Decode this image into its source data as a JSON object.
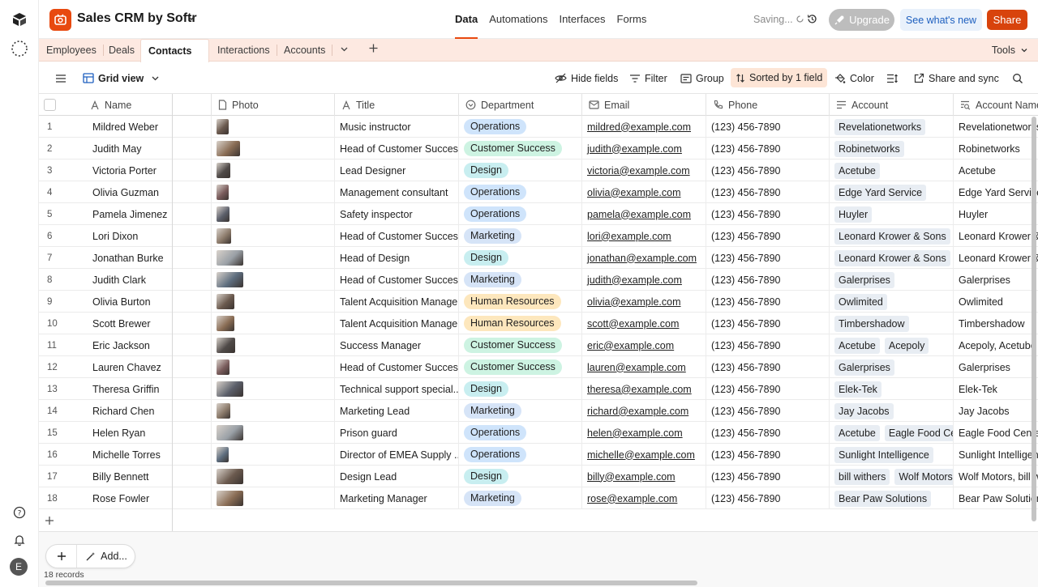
{
  "header": {
    "base_name": "Sales CRM by Softr",
    "nav": [
      "Data",
      "Automations",
      "Interfaces",
      "Forms"
    ],
    "active_nav": "Data",
    "saving": "Saving...",
    "upgrade": "Upgrade",
    "whats_new": "See what's new",
    "share": "Share"
  },
  "rail": {
    "avatar": "E"
  },
  "tabs": {
    "items": [
      "Employees",
      "Deals",
      "Contacts",
      "Interactions",
      "Accounts"
    ],
    "active": "Contacts",
    "tools": "Tools"
  },
  "viewbar": {
    "view_name": "Grid view",
    "hide_fields": "Hide fields",
    "filter": "Filter",
    "group": "Group",
    "sorted": "Sorted by 1 field",
    "color": "Color",
    "share_sync": "Share and sync"
  },
  "columns": [
    "Name",
    "Photo",
    "Title",
    "Department",
    "Email",
    "Phone",
    "Account",
    "Account Name"
  ],
  "departments": {
    "Operations": "#cfe4fb",
    "Customer Success": "#cdf3e2",
    "Design": "#c8eef0",
    "Marketing": "#d6e4f7",
    "Human Resources": "#fde7bd"
  },
  "rows": [
    {
      "n": "1",
      "name": "Mildred Weber",
      "photo_w": 15,
      "title": "Music instructor",
      "dept": "Operations",
      "email": "mildred@example.com",
      "phone": "(123) 456-7890",
      "accounts": [
        "Revelationetworks"
      ],
      "account_name": "Revelationetworks"
    },
    {
      "n": "2",
      "name": "Judith May",
      "photo_w": 29,
      "title": "Head of Customer Success",
      "dept": "Customer Success",
      "email": "judith@example.com",
      "phone": "(123) 456-7890",
      "accounts": [
        "Robinetworks"
      ],
      "account_name": "Robinetworks"
    },
    {
      "n": "3",
      "name": "Victoria Porter",
      "photo_w": 17,
      "title": "Lead Designer",
      "dept": "Design",
      "email": "victoria@example.com",
      "phone": "(123) 456-7890",
      "accounts": [
        "Acetube"
      ],
      "account_name": "Acetube"
    },
    {
      "n": "4",
      "name": "Olivia Guzman",
      "photo_w": 15,
      "title": "Management consultant",
      "dept": "Operations",
      "email": "olivia@example.com",
      "phone": "(123) 456-7890",
      "accounts": [
        "Edge Yard Service"
      ],
      "account_name": "Edge Yard Service"
    },
    {
      "n": "5",
      "name": "Pamela Jimenez",
      "photo_w": 16,
      "title": "Safety inspector",
      "dept": "Operations",
      "email": "pamela@example.com",
      "phone": "(123) 456-7890",
      "accounts": [
        "Huyler"
      ],
      "account_name": "Huyler"
    },
    {
      "n": "6",
      "name": "Lori Dixon",
      "photo_w": 18,
      "title": "Head of Customer Success",
      "dept": "Marketing",
      "email": "lori@example.com",
      "phone": "(123) 456-7890",
      "accounts": [
        "Leonard Krower & Sons"
      ],
      "account_name": "Leonard Krower & Sons"
    },
    {
      "n": "7",
      "name": "Jonathan Burke",
      "photo_w": 33,
      "title": "Head of Design",
      "dept": "Design",
      "email": "jonathan@example.com",
      "phone": "(123) 456-7890",
      "accounts": [
        "Leonard Krower & Sons"
      ],
      "account_name": "Leonard Krower & Sons"
    },
    {
      "n": "8",
      "name": "Judith Clark",
      "photo_w": 33,
      "title": "Head of Customer Success",
      "dept": "Marketing",
      "email": "judith@example.com",
      "phone": "(123) 456-7890",
      "accounts": [
        "Galerprises"
      ],
      "account_name": "Galerprises"
    },
    {
      "n": "9",
      "name": "Olivia Burton",
      "photo_w": 22,
      "title": "Talent Acquisition Manager",
      "dept": "Human Resources",
      "email": "olivia@example.com",
      "phone": "(123) 456-7890",
      "accounts": [
        "Owlimited"
      ],
      "account_name": "Owlimited"
    },
    {
      "n": "10",
      "name": "Scott Brewer",
      "photo_w": 22,
      "title": "Talent Acquisition Manager",
      "dept": "Human Resources",
      "email": "scott@example.com",
      "phone": "(123) 456-7890",
      "accounts": [
        "Timbershadow"
      ],
      "account_name": "Timbershadow"
    },
    {
      "n": "11",
      "name": "Eric Jackson",
      "photo_w": 23,
      "title": "Success Manager",
      "dept": "Customer Success",
      "email": "eric@example.com",
      "phone": "(123) 456-7890",
      "accounts": [
        "Acetube",
        "Acepoly"
      ],
      "account_name": "Acepoly, Acetube"
    },
    {
      "n": "12",
      "name": "Lauren Chavez",
      "photo_w": 16,
      "title": "Head of Customer Success",
      "dept": "Customer Success",
      "email": "lauren@example.com",
      "phone": "(123) 456-7890",
      "accounts": [
        "Galerprises"
      ],
      "account_name": "Galerprises"
    },
    {
      "n": "13",
      "name": "Theresa Griffin",
      "photo_w": 33,
      "title": "Technical support special...",
      "dept": "Design",
      "email": "theresa@example.com",
      "phone": "(123) 456-7890",
      "accounts": [
        "Elek-Tek"
      ],
      "account_name": "Elek-Tek"
    },
    {
      "n": "14",
      "name": "Richard Chen",
      "photo_w": 17,
      "title": "Marketing Lead",
      "dept": "Marketing",
      "email": "richard@example.com",
      "phone": "(123) 456-7890",
      "accounts": [
        "Jay Jacobs"
      ],
      "account_name": "Jay Jacobs"
    },
    {
      "n": "15",
      "name": "Helen Ryan",
      "photo_w": 33,
      "title": "Prison guard",
      "dept": "Operations",
      "email": "helen@example.com",
      "phone": "(123) 456-7890",
      "accounts": [
        "Acetube",
        "Eagle Food Centers"
      ],
      "account_name": "Eagle Food Centers"
    },
    {
      "n": "16",
      "name": "Michelle Torres",
      "photo_w": 15,
      "title": "Director of EMEA Supply ...",
      "dept": "Operations",
      "email": "michelle@example.com",
      "phone": "(123) 456-7890",
      "accounts": [
        "Sunlight Intelligence"
      ],
      "account_name": "Sunlight Intelligence"
    },
    {
      "n": "17",
      "name": "Billy Bennett",
      "photo_w": 33,
      "title": "Design Lead",
      "dept": "Design",
      "email": "billy@example.com",
      "phone": "(123) 456-7890",
      "accounts": [
        "bill withers",
        "Wolf Motors"
      ],
      "account_name": "Wolf Motors, bill withers"
    },
    {
      "n": "18",
      "name": "Rose Fowler",
      "photo_w": 33,
      "title": "Marketing Manager",
      "dept": "Marketing",
      "email": "rose@example.com",
      "phone": "(123) 456-7890",
      "accounts": [
        "Bear Paw Solutions"
      ],
      "account_name": "Bear Paw Solutions"
    }
  ],
  "footer": {
    "add": "Add...",
    "records": "18 records"
  }
}
